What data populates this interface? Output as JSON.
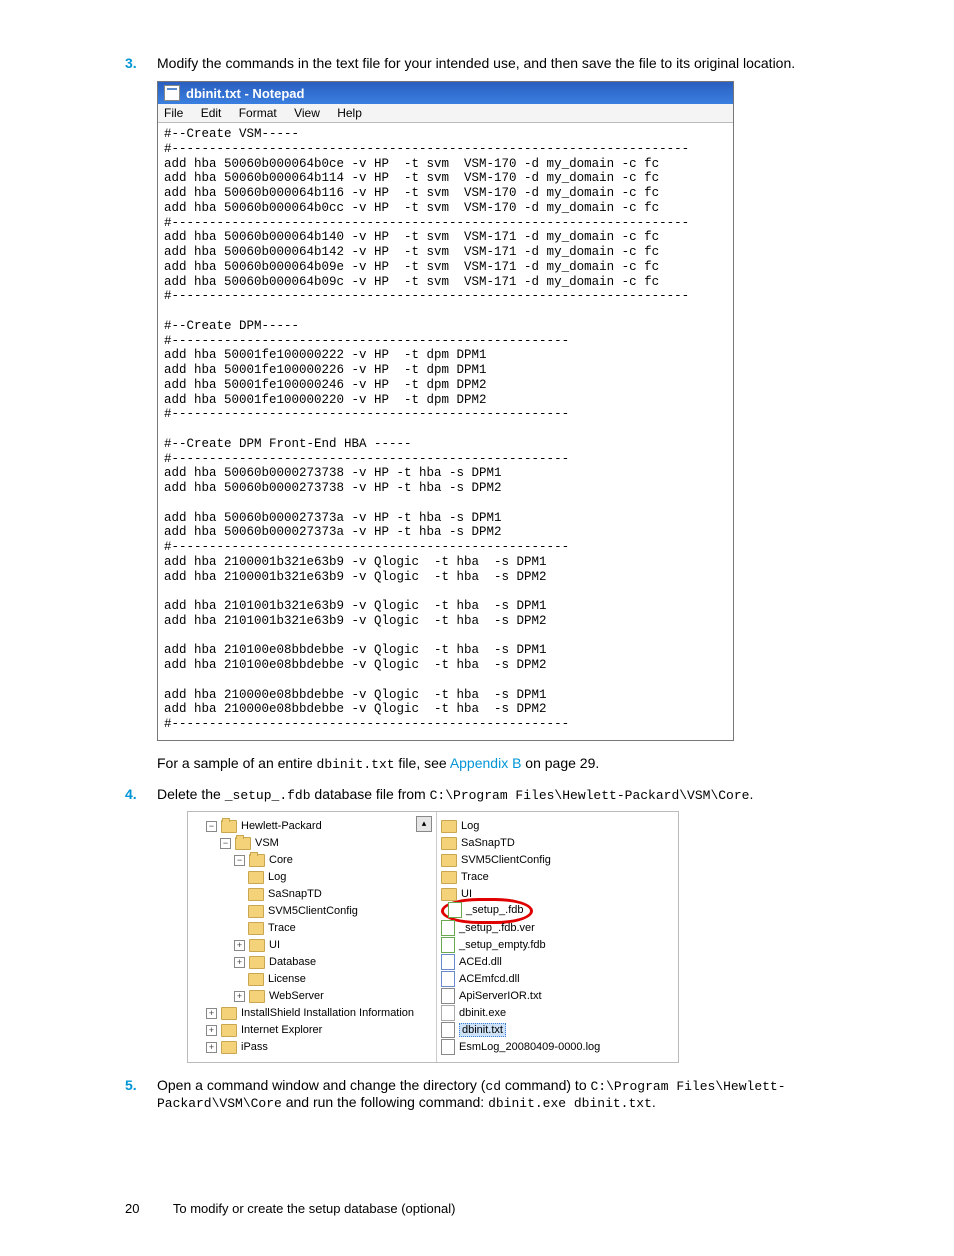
{
  "steps": {
    "s3": {
      "num": "3.",
      "text": "Modify the commands in the text file for your intended use, and then save the file to its original location."
    },
    "s3a": {
      "pre": "For a sample of an entire ",
      "code": "dbinit.txt",
      "mid": " file, see ",
      "link": "Appendix B",
      "post": " on page 29."
    },
    "s4": {
      "num": "4.",
      "pre": "Delete the ",
      "code1": "_setup_.fdb",
      "mid1": " database file from ",
      "code2": "C:\\Program Files\\Hewlett-Packard\\VSM\\Core",
      "post": "."
    },
    "s5": {
      "num": "5.",
      "pre": "Open a command window and change the directory (",
      "cd": "cd",
      "mid": " command) to ",
      "path": "C:\\Program Files\\Hewlett-Packard\\VSM\\Core",
      "mid2": " and run the following command: ",
      "cmd": "dbinit.exe dbinit.txt",
      "post": "."
    }
  },
  "notepad": {
    "title": "dbinit.txt - Notepad",
    "menu": {
      "file": "File",
      "edit": "Edit",
      "format": "Format",
      "view": "View",
      "help": "Help"
    },
    "body": "#--Create VSM-----\n#---------------------------------------------------------------------\nadd hba 50060b000064b0ce -v HP  -t svm  VSM-170 -d my_domain -c fc\nadd hba 50060b000064b114 -v HP  -t svm  VSM-170 -d my_domain -c fc\nadd hba 50060b000064b116 -v HP  -t svm  VSM-170 -d my_domain -c fc\nadd hba 50060b000064b0cc -v HP  -t svm  VSM-170 -d my_domain -c fc\n#---------------------------------------------------------------------\nadd hba 50060b000064b140 -v HP  -t svm  VSM-171 -d my_domain -c fc\nadd hba 50060b000064b142 -v HP  -t svm  VSM-171 -d my_domain -c fc\nadd hba 50060b000064b09e -v HP  -t svm  VSM-171 -d my_domain -c fc\nadd hba 50060b000064b09c -v HP  -t svm  VSM-171 -d my_domain -c fc\n#---------------------------------------------------------------------\n\n#--Create DPM-----\n#-----------------------------------------------------\nadd hba 50001fe100000222 -v HP  -t dpm DPM1\nadd hba 50001fe100000226 -v HP  -t dpm DPM1\nadd hba 50001fe100000246 -v HP  -t dpm DPM2\nadd hba 50001fe100000220 -v HP  -t dpm DPM2\n#-----------------------------------------------------\n\n#--Create DPM Front-End HBA -----\n#-----------------------------------------------------\nadd hba 50060b0000273738 -v HP -t hba -s DPM1\nadd hba 50060b0000273738 -v HP -t hba -s DPM2\n\nadd hba 50060b000027373a -v HP -t hba -s DPM1\nadd hba 50060b000027373a -v HP -t hba -s DPM2\n#-----------------------------------------------------\nadd hba 2100001b321e63b9 -v Qlogic  -t hba  -s DPM1\nadd hba 2100001b321e63b9 -v Qlogic  -t hba  -s DPM2\n\nadd hba 2101001b321e63b9 -v Qlogic  -t hba  -s DPM1\nadd hba 2101001b321e63b9 -v Qlogic  -t hba  -s DPM2\n\nadd hba 210100e08bbdebbe -v Qlogic  -t hba  -s DPM1\nadd hba 210100e08bbdebbe -v Qlogic  -t hba  -s DPM2\n\nadd hba 210000e08bbdebbe -v Qlogic  -t hba  -s DPM1\nadd hba 210000e08bbdebbe -v Qlogic  -t hba  -s DPM2\n#-----------------------------------------------------"
  },
  "tree": {
    "left": [
      "Hewlett-Packard",
      "VSM",
      "Core",
      "Log",
      "SaSnapTD",
      "SVM5ClientConfig",
      "Trace",
      "UI",
      "Database",
      "License",
      "WebServer",
      "InstallShield Installation Information",
      "Internet Explorer",
      "iPass"
    ],
    "right": {
      "folders": [
        "Log",
        "SaSnapTD",
        "SVM5ClientConfig",
        "Trace",
        "UI"
      ],
      "files": [
        "_setup_.fdb",
        "_setup_.fdb.ver",
        "_setup_empty.fdb",
        "ACEd.dll",
        "ACEmfcd.dll",
        "ApiServerIOR.txt",
        "dbinit.exe",
        "dbinit.txt",
        "EsmLog_20080409-0000.log"
      ],
      "highlight": "_setup_.fdb",
      "selected": "dbinit.txt"
    }
  },
  "footer": {
    "page": "20",
    "title": "To modify or create the setup database (optional)"
  }
}
